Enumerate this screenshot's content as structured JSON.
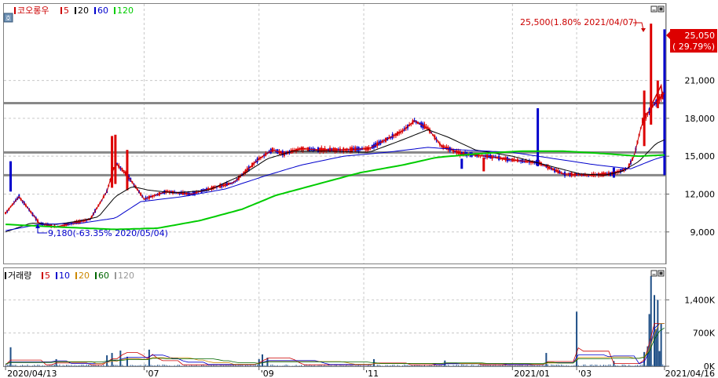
{
  "price_panel": {
    "icon_glyph": "호",
    "legend": [
      {
        "label": "코오롱우",
        "color": "#cc0000"
      },
      {
        "label": "5",
        "color": "#cc0000"
      },
      {
        "label": "20",
        "color": "#000000"
      },
      {
        "label": "60",
        "color": "#0000cc"
      },
      {
        "label": "120",
        "color": "#00cc00"
      }
    ],
    "high_annotation": "25,500(1.80% 2021/04/07)",
    "low_annotation": "9,180(-63.35% 2020/05/04)",
    "current_price": "25,050",
    "current_change": "( 29.79%)",
    "colors": {
      "up": "#dd0000",
      "down": "#0000cc",
      "ma5": "#cc0000",
      "ma20": "#000000",
      "ma60": "#0000cc",
      "ma120": "#00cc00",
      "level_line": "#888888"
    }
  },
  "volume_panel": {
    "legend": [
      {
        "label": "거래량",
        "color": "#000000"
      },
      {
        "label": "5",
        "color": "#cc0000"
      },
      {
        "label": "10",
        "color": "#0000cc"
      },
      {
        "label": "20",
        "color": "#cc8800"
      },
      {
        "label": "60",
        "color": "#006600"
      },
      {
        "label": "120",
        "color": "#999999"
      }
    ],
    "bar_color": "#1f4f86"
  },
  "chart_data": [
    {
      "type": "candlestick",
      "title": "코오롱우",
      "x_start": "2020/04/13",
      "x_end": "2021/04/16",
      "y_ticks": [
        "21,000",
        "18,000",
        "15,000",
        "12,000",
        "9,000"
      ],
      "ylim": [
        6500,
        27000
      ],
      "horizontal_levels": [
        19200,
        15300,
        13500
      ],
      "series": [
        {
          "name": "5",
          "anchors": [
            [
              0,
              10500
            ],
            [
              8,
              11800
            ],
            [
              20,
              9700
            ],
            [
              30,
              9400
            ],
            [
              40,
              9700
            ],
            [
              50,
              10000
            ],
            [
              60,
              12200
            ],
            [
              65,
              14500
            ],
            [
              72,
              13500
            ],
            [
              82,
              11600
            ],
            [
              95,
              12200
            ],
            [
              110,
              12000
            ],
            [
              120,
              12400
            ],
            [
              135,
              12900
            ],
            [
              150,
              14800
            ],
            [
              158,
              15500
            ],
            [
              165,
              15200
            ],
            [
              175,
              15600
            ],
            [
              185,
              15500
            ],
            [
              200,
              15500
            ],
            [
              215,
              15600
            ],
            [
              225,
              16300
            ],
            [
              235,
              17000
            ],
            [
              242,
              17800
            ],
            [
              250,
              17200
            ],
            [
              258,
              15800
            ],
            [
              270,
              15200
            ],
            [
              285,
              15000
            ],
            [
              300,
              14700
            ],
            [
              315,
              14500
            ],
            [
              330,
              13600
            ],
            [
              345,
              13500
            ],
            [
              358,
              13600
            ],
            [
              368,
              14000
            ],
            [
              372,
              15000
            ],
            [
              377,
              17800
            ],
            [
              383,
              19000
            ],
            [
              390,
              20000
            ]
          ]
        },
        {
          "name": "20",
          "anchors": [
            [
              0,
              9000
            ],
            [
              15,
              9700
            ],
            [
              30,
              9600
            ],
            [
              45,
              9900
            ],
            [
              55,
              10200
            ],
            [
              65,
              11800
            ],
            [
              75,
              12600
            ],
            [
              85,
              12300
            ],
            [
              100,
              12100
            ],
            [
              120,
              12300
            ],
            [
              140,
              13500
            ],
            [
              155,
              14800
            ],
            [
              170,
              15400
            ],
            [
              190,
              15400
            ],
            [
              215,
              15300
            ],
            [
              235,
              16300
            ],
            [
              250,
              17100
            ],
            [
              262,
              16500
            ],
            [
              278,
              15500
            ],
            [
              300,
              15000
            ],
            [
              320,
              14300
            ],
            [
              340,
              13600
            ],
            [
              355,
              13500
            ],
            [
              365,
              13800
            ],
            [
              375,
              14600
            ],
            [
              385,
              16000
            ],
            [
              390,
              16300
            ]
          ]
        },
        {
          "name": "60",
          "anchors": [
            [
              0,
              9100
            ],
            [
              20,
              9600
            ],
            [
              45,
              9700
            ],
            [
              65,
              10100
            ],
            [
              80,
              11400
            ],
            [
              105,
              11800
            ],
            [
              130,
              12400
            ],
            [
              155,
              13500
            ],
            [
              175,
              14300
            ],
            [
              200,
              15000
            ],
            [
              225,
              15300
            ],
            [
              250,
              15700
            ],
            [
              270,
              15500
            ],
            [
              300,
              15300
            ],
            [
              325,
              14800
            ],
            [
              350,
              14300
            ],
            [
              370,
              14000
            ],
            [
              383,
              14700
            ],
            [
              390,
              15000
            ]
          ]
        },
        {
          "name": "120",
          "anchors": [
            [
              0,
              9600
            ],
            [
              30,
              9400
            ],
            [
              65,
              9200
            ],
            [
              90,
              9300
            ],
            [
              115,
              9900
            ],
            [
              140,
              10800
            ],
            [
              160,
              11900
            ],
            [
              185,
              12800
            ],
            [
              210,
              13700
            ],
            [
              235,
              14300
            ],
            [
              255,
              14900
            ],
            [
              280,
              15200
            ],
            [
              305,
              15400
            ],
            [
              330,
              15400
            ],
            [
              355,
              15200
            ],
            [
              375,
              15000
            ],
            [
              390,
              15100
            ]
          ]
        }
      ],
      "annotations": {
        "high": {
          "value": 25500,
          "date": "2021/04/07"
        },
        "low": {
          "value": 9180,
          "date": "2020/05/04"
        },
        "last": {
          "value": 25050,
          "change_pct": 29.79
        }
      }
    },
    {
      "type": "bar",
      "title": "거래량",
      "y_ticks": [
        "1,400K",
        "700K",
        "0K"
      ],
      "ylim": [
        0,
        2050
      ],
      "spikes": [
        [
          3,
          400
        ],
        [
          30,
          150
        ],
        [
          60,
          230
        ],
        [
          63,
          280
        ],
        [
          68,
          330
        ],
        [
          72,
          200
        ],
        [
          85,
          350
        ],
        [
          150,
          150
        ],
        [
          152,
          250
        ],
        [
          155,
          180
        ],
        [
          218,
          150
        ],
        [
          260,
          120
        ],
        [
          320,
          280
        ],
        [
          338,
          1150
        ],
        [
          360,
          110
        ],
        [
          378,
          300
        ],
        [
          380,
          420
        ],
        [
          381,
          1100
        ],
        [
          382,
          1900
        ],
        [
          384,
          1500
        ],
        [
          385,
          780
        ],
        [
          386,
          1400
        ],
        [
          387,
          320
        ],
        [
          388,
          900
        ]
      ]
    }
  ],
  "x_axis": {
    "labels": [
      {
        "text": "2020/04/13",
        "pos": 0
      },
      {
        "text": "'07",
        "pos": 82
      },
      {
        "text": "'09",
        "pos": 150
      },
      {
        "text": "'11",
        "pos": 212
      },
      {
        "text": "2021/01",
        "pos": 300
      },
      {
        "text": "'03",
        "pos": 338
      },
      {
        "text": "2021/04/16",
        "pos": 390
      }
    ]
  }
}
